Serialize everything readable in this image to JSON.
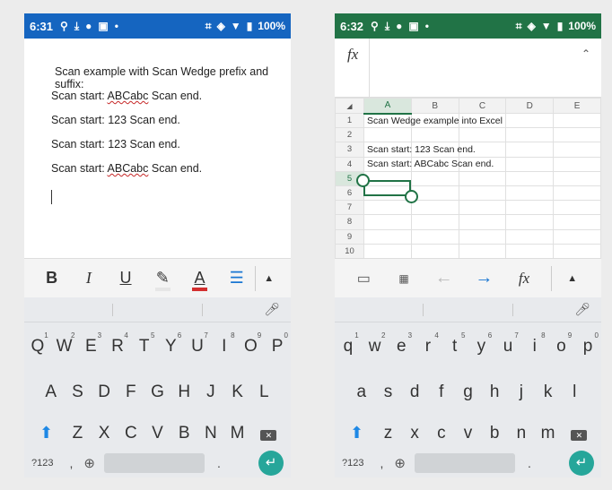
{
  "left": {
    "status": {
      "time": "6:31",
      "battery": "100%"
    },
    "doc": {
      "heading": "Scan example with Scan Wedge prefix and suffix:",
      "lines": [
        {
          "pre": "Scan start: ",
          "squig": "ABCabc",
          "post": " Scan end."
        },
        {
          "pre": "Scan start: 123 Scan end.",
          "squig": "",
          "post": ""
        },
        {
          "pre": "Scan start: 123 Scan end.",
          "squig": "",
          "post": ""
        },
        {
          "pre": "Scan start: ",
          "squig": "ABCabc",
          "post": " Scan end."
        }
      ]
    },
    "toolbar": {
      "bold": "B",
      "italic": "I",
      "underline": "U",
      "font_color": "A"
    },
    "keyboard": {
      "row1": [
        "Q",
        "W",
        "E",
        "R",
        "T",
        "Y",
        "U",
        "I",
        "O",
        "P"
      ],
      "row1_nums": [
        "1",
        "2",
        "3",
        "4",
        "5",
        "6",
        "7",
        "8",
        "9",
        "0"
      ],
      "row2": [
        "A",
        "S",
        "D",
        "F",
        "G",
        "H",
        "J",
        "K",
        "L"
      ],
      "row3": [
        "Z",
        "X",
        "C",
        "V",
        "B",
        "N",
        "M"
      ],
      "sym": "?123",
      "comma": ",",
      "period": "."
    }
  },
  "right": {
    "status": {
      "time": "6:32",
      "battery": "100%"
    },
    "formula": {
      "fx": "fx"
    },
    "columns": [
      "A",
      "B",
      "C",
      "D",
      "E"
    ],
    "rows": [
      "1",
      "2",
      "3",
      "4",
      "5",
      "6",
      "7",
      "8",
      "9",
      "10"
    ],
    "cells": [
      "Scan Wedge example into Excel",
      "",
      "Scan start: 123 Scan end.",
      "Scan start: ABCabc Scan end.",
      "",
      "",
      "",
      "",
      "",
      ""
    ],
    "toolbar": {
      "fx": "fx"
    },
    "keyboard": {
      "row1": [
        "q",
        "w",
        "e",
        "r",
        "t",
        "y",
        "u",
        "i",
        "o",
        "p"
      ],
      "row1_nums": [
        "1",
        "2",
        "3",
        "4",
        "5",
        "6",
        "7",
        "8",
        "9",
        "0"
      ],
      "row2": [
        "a",
        "s",
        "d",
        "f",
        "g",
        "h",
        "j",
        "k",
        "l"
      ],
      "row3": [
        "z",
        "x",
        "c",
        "v",
        "b",
        "n",
        "m"
      ],
      "sym": "?123",
      "comma": ",",
      "period": "."
    }
  },
  "colors": {
    "word_status": "#1565c0",
    "excel_status": "#217346",
    "enter": "#26a69a"
  }
}
